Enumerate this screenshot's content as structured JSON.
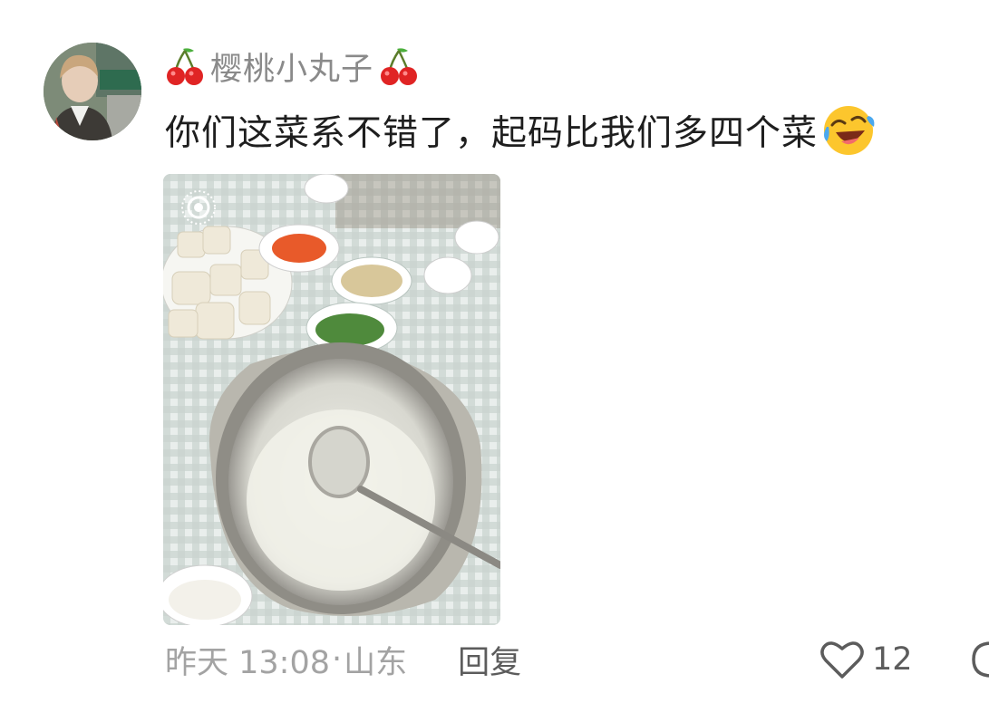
{
  "user": {
    "name": "樱桃小丸子",
    "prefix_icon": "cherry-icon",
    "suffix_icon": "cherry-icon",
    "avatar": "avatar"
  },
  "comment": {
    "text": "你们这菜系不错了，起码比我们多四个菜",
    "emoji": "rolling-laughing-emoji"
  },
  "photo": {
    "badge_icon": "live-photo-icon"
  },
  "meta": {
    "time": "昨天 13:08",
    "separator": "·",
    "location": "山东",
    "reply_label": "回复"
  },
  "actions": {
    "like_icon": "heart-icon",
    "like_count": "12"
  },
  "colors": {
    "primary_text": "#1e1e1e",
    "secondary_text": "#8a8a8a",
    "meta_text": "#a3a3a3",
    "action_text": "#5c5c5c",
    "background": "#ffffff"
  }
}
